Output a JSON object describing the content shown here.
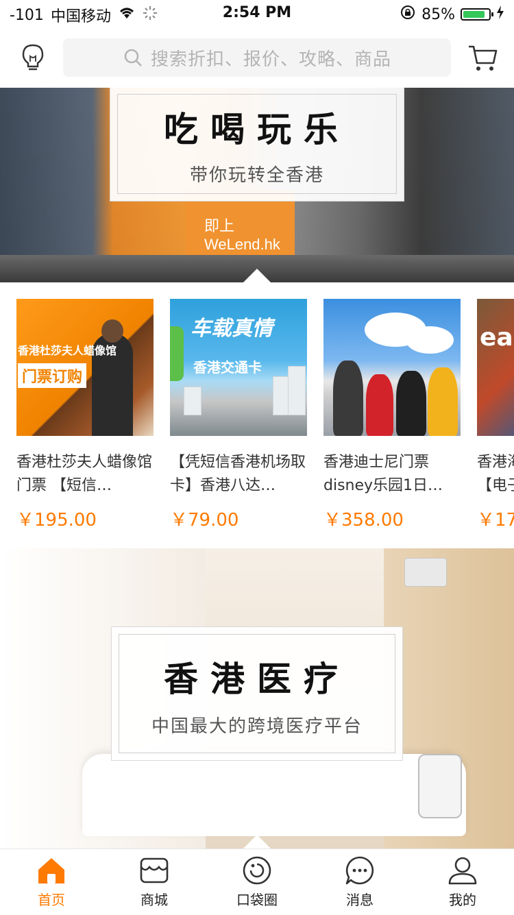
{
  "status_bar": {
    "signal": "-101",
    "carrier": "中国移动",
    "time": "2:54 PM",
    "battery_percent": "85%",
    "battery_level": 0.85
  },
  "header": {
    "search_placeholder": "搜索折扣、报价、攻略、商品",
    "left_icon": "lightbulb-icon",
    "right_icon": "cart-icon"
  },
  "banner_eat": {
    "title": "吃喝玩乐",
    "subtitle": "带你玩转全香港",
    "bus_sign": "即上 WeLend.hk"
  },
  "products": [
    {
      "title": "香港杜莎夫人蜡像馆门票 【短信…",
      "price": "￥195.00",
      "img_text_1": "香港杜莎夫人蜡像馆",
      "img_text_2": "门票订购"
    },
    {
      "title": "【凭短信香港机场取卡】香港八达…",
      "price": "￥79.00",
      "img_text_1": "车载真情",
      "img_text_2": "香港交通卡"
    },
    {
      "title": "香港迪士尼门票disney乐园1日…",
      "price": "￥358.00"
    },
    {
      "title": "香港海洋公园门票【电子…",
      "price": "￥17",
      "img_text_1": "ean"
    }
  ],
  "banner_medical": {
    "title": "香港医疗",
    "subtitle": "中国最大的跨境医疗平台"
  },
  "tabbar": {
    "items": [
      {
        "label": "首页",
        "icon": "home-icon",
        "active": true
      },
      {
        "label": "商城",
        "icon": "shop-icon",
        "active": false
      },
      {
        "label": "口袋圈",
        "icon": "pocket-circle-icon",
        "active": false
      },
      {
        "label": "消息",
        "icon": "message-icon",
        "active": false
      },
      {
        "label": "我的",
        "icon": "profile-icon",
        "active": false
      }
    ]
  },
  "colors": {
    "accent": "#ff7a00",
    "battery_green": "#35c759",
    "text": "#333333",
    "placeholder": "#b4b4b4"
  }
}
